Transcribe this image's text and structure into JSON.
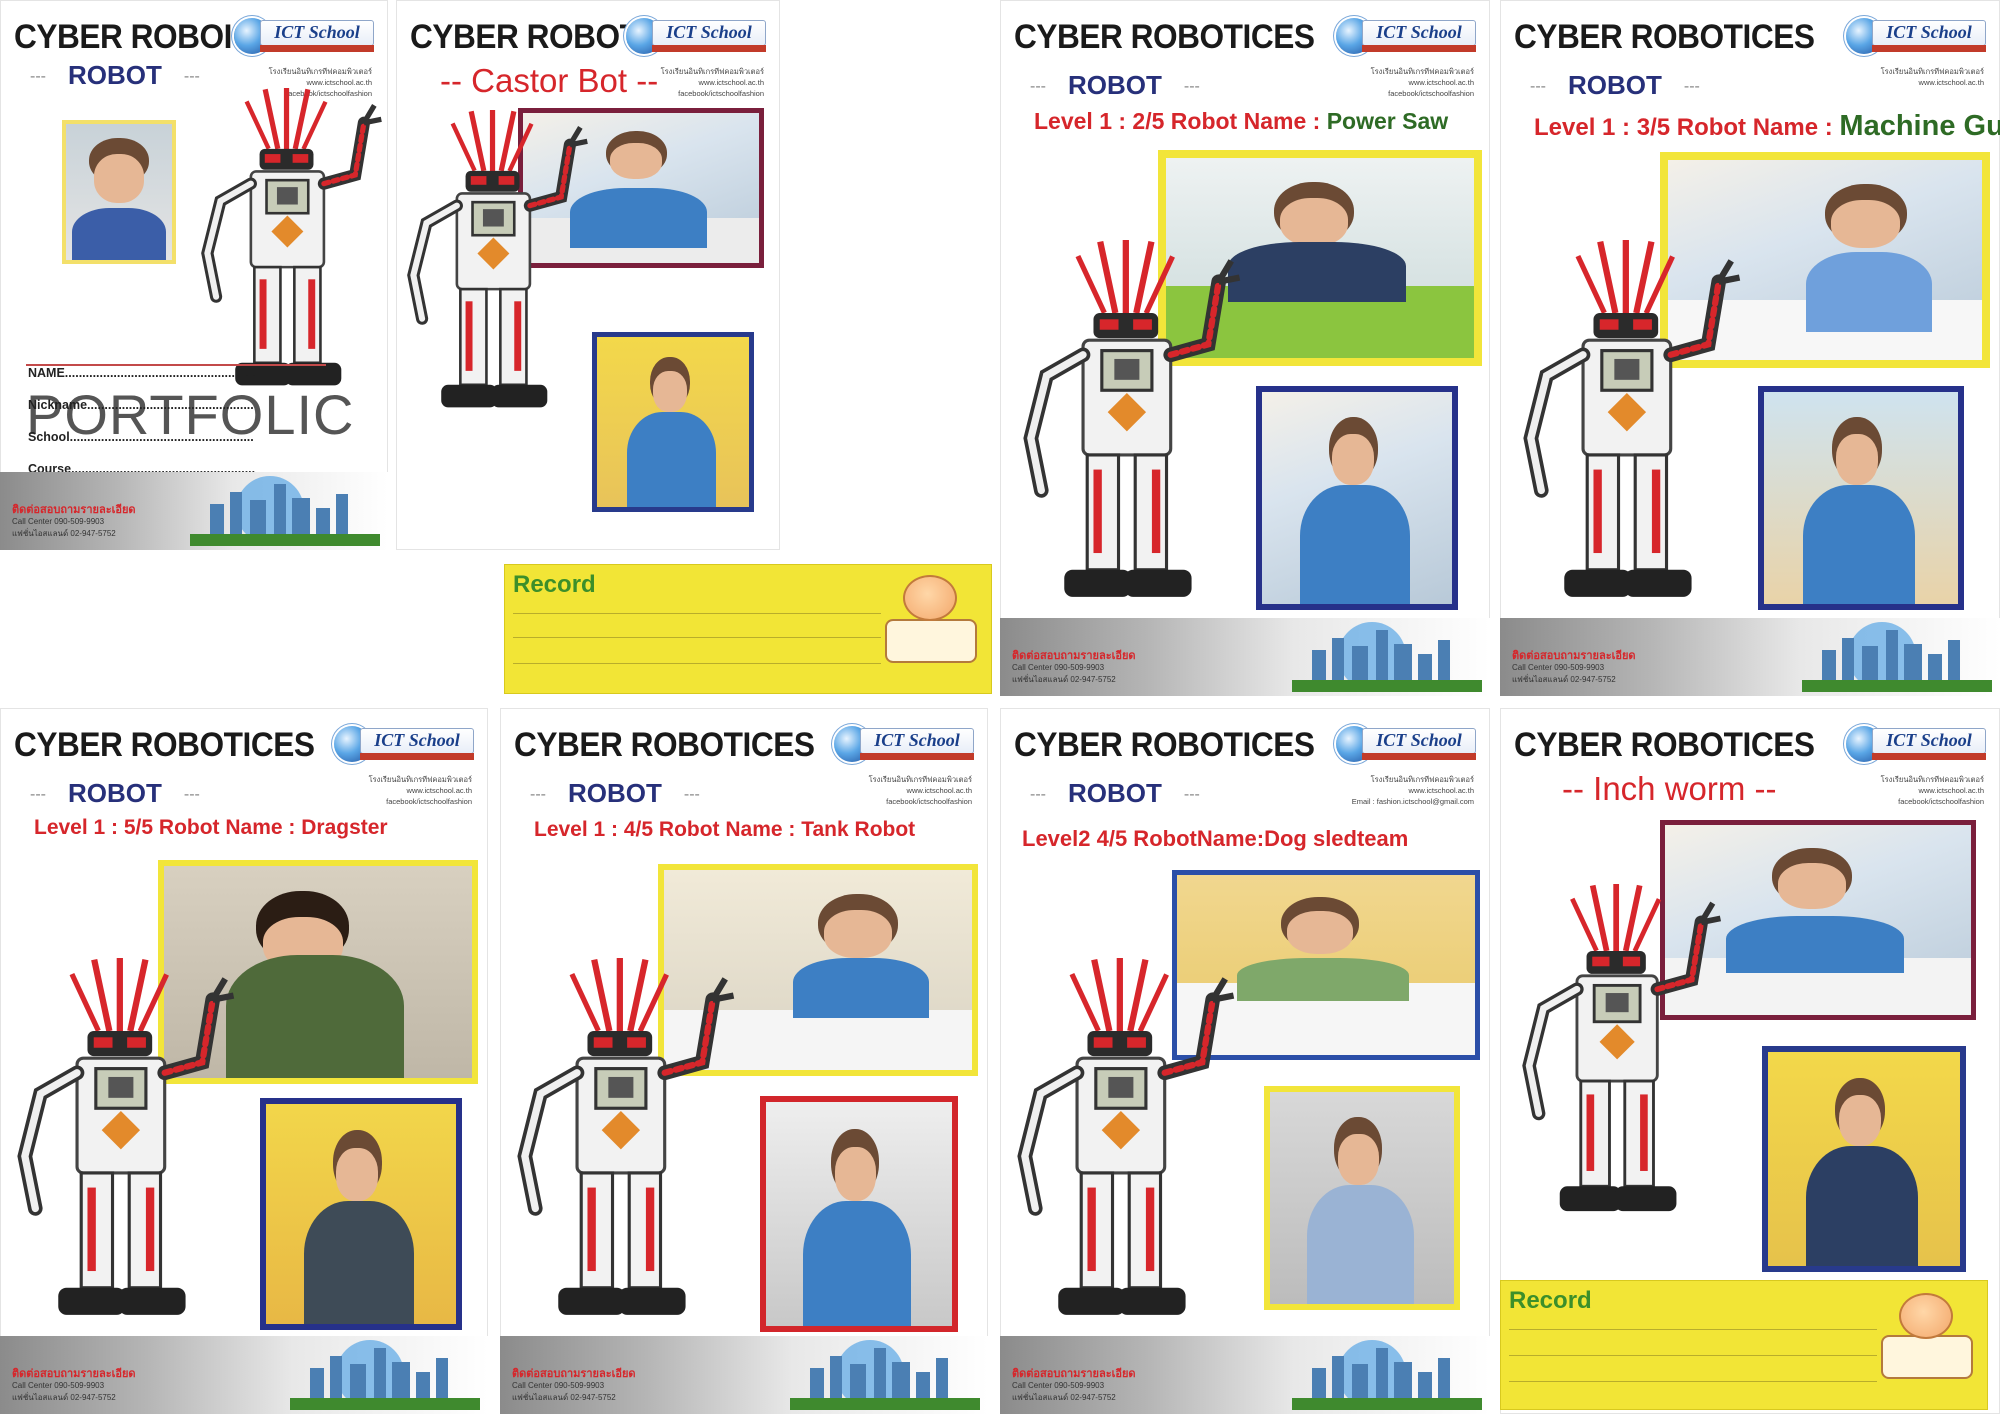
{
  "pages": [
    {
      "title": "CYBER ROBOICES",
      "robot_label": "ROBOT",
      "logo": "ICT School",
      "contact": [
        "โรงเรียนอินทิเกรทีฟคอมพิวเตอร์",
        "www.ictschool.ac.th",
        "facebook/ictschoolfashion"
      ],
      "portfolio_text": "PORTFOLIC",
      "form": {
        "name": "NAME........................................................",
        "nickname": "Nickname................................................",
        "school": "School.....................................................",
        "course": "Course....................................................."
      },
      "footer": {
        "head": "ติดต่อสอบถามรายละเอียด",
        "line1": "Call Center  090-509-9903",
        "line2": "แฟชั่นไอสแลนด์ 02-947-5752"
      }
    },
    {
      "title": "CYBER ROBOTICES",
      "subtitle": "-- Castor Bot --",
      "logo": "ICT School",
      "contact": [
        "โรงเรียนอินทิเกรทีฟคอมพิวเตอร์",
        "www.ictschool.ac.th",
        "facebook/ictschoolfashion"
      ],
      "record_label": "Record"
    },
    {
      "title": "CYBER ROBOTICES",
      "robot_label": "ROBOT",
      "subtitle_prefix": "Level 1 : 2/5  Robot Name : ",
      "subtitle_name": "Power Saw",
      "logo": "ICT School",
      "contact": [
        "โรงเรียนอินทิเกรทีฟคอมพิวเตอร์",
        "www.ictschool.ac.th",
        "facebook/ictschoolfashion"
      ],
      "footer": {
        "head": "ติดต่อสอบถามรายละเอียด",
        "line1": "Call Center  090-509-9903",
        "line2": "แฟชั่นไอสแลนด์ 02-947-5752"
      }
    },
    {
      "title": "CYBER ROBOTICES",
      "robot_label": "ROBOT",
      "subtitle_prefix": "Level   1  :  3/5  Robot Name : ",
      "subtitle_name": "Machine Gun",
      "logo": "ICT School",
      "contact": [
        "โรงเรียนอินทิเกรทีฟคอมพิวเตอร์",
        "www.ictschool.ac.th"
      ],
      "footer": {
        "head": "ติดต่อสอบถามรายละเอียด",
        "line1": "Call Center  090-509-9903",
        "line2": "แฟชั่นไอสแลนด์ 02-947-5752"
      }
    },
    {
      "title": "CYBER ROBOTICES",
      "robot_label": "ROBOT",
      "subtitle": "Level 1 : 5/5  Robot Name : Dragster",
      "logo": "ICT School",
      "contact": [
        "โรงเรียนอินทิเกรทีฟคอมพิวเตอร์",
        "www.ictschool.ac.th",
        "facebook/ictschoolfashion"
      ],
      "footer": {
        "head": "ติดต่อสอบถามรายละเอียด",
        "line1": "Call Center  090-509-9903",
        "line2": "แฟชั่นไอสแลนด์ 02-947-5752"
      }
    },
    {
      "title": "CYBER ROBOTICES",
      "robot_label": "ROBOT",
      "subtitle": "Level 1 : 4/5  Robot Name : Tank Robot",
      "logo": "ICT School",
      "contact": [
        "โรงเรียนอินทิเกรทีฟคอมพิวเตอร์",
        "www.ictschool.ac.th",
        "facebook/ictschoolfashion"
      ],
      "footer": {
        "head": "ติดต่อสอบถามรายละเอียด",
        "line1": "Call Center  090-509-9903",
        "line2": "แฟชั่นไอสแลนด์ 02-947-5752"
      }
    },
    {
      "title": "CYBER ROBOTICES",
      "robot_label": "ROBOT",
      "subtitle": "Level2 4/5 RobotName:Dog sledteam",
      "logo": "ICT School",
      "contact": [
        "โรงเรียนอินทิเกรทีฟคอมพิวเตอร์",
        "www.ictschool.ac.th",
        "Email : fashion.ictschool@gmail.com"
      ],
      "footer": {
        "head": "ติดต่อสอบถามรายละเอียด",
        "line1": "Call Center  090-509-9903",
        "line2": "แฟชั่นไอสแลนด์ 02-947-5752"
      }
    },
    {
      "title": "CYBER ROBOTICES",
      "subtitle": "-- Inch worm --",
      "logo": "ICT School",
      "contact": [
        "โรงเรียนอินทิเกรทีฟคอมพิวเตอร์",
        "www.ictschool.ac.th",
        "facebook/ictschoolfashion"
      ],
      "record_label": "Record"
    }
  ],
  "colors": {
    "title": "#1a1a1a",
    "robot_label": "#27307a",
    "subtitle_red": "#d6262b",
    "robot_name_green": "#2e6b25",
    "record_yellow": "#f2e536",
    "record_text": "#3c8f2a"
  }
}
